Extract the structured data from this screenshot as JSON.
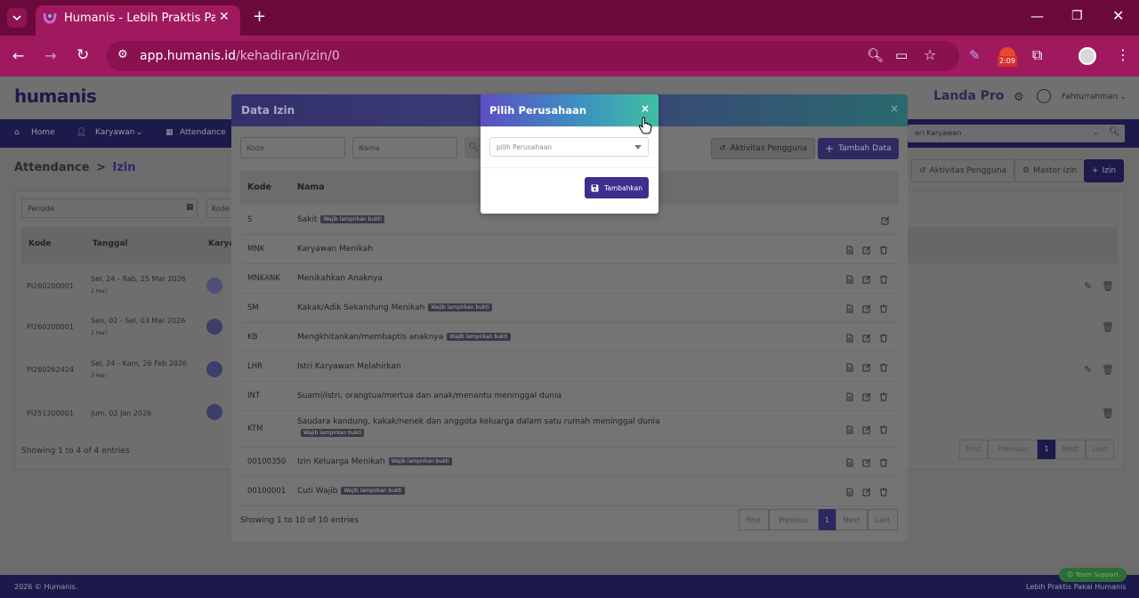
{
  "browser": {
    "tab_title": "Humanis - Lebih Praktis Pakai H",
    "url_domain": "app.humanis.id",
    "url_path": "/kehadiran/izin/0",
    "profile_badge": "2:09",
    "accent": "#a0195f"
  },
  "app": {
    "logo": "humanis",
    "company": "Landa Pro",
    "user": "Fahturrahman",
    "nav": [
      "Home",
      "Karyawan",
      "Attendance"
    ],
    "nav_search_placeholder": "ari Karyawan",
    "breadcrumb_root": "Attendance",
    "breadcrumb_sep": ">",
    "breadcrumb_current": "Izin",
    "btn_aktivitas": "Aktivitas Pengguna",
    "btn_master": "Master Izin",
    "btn_izin": "Izin",
    "filter_periode": "Periode",
    "filter_kode": "Kode",
    "columns": [
      "Kode",
      "Tanggal",
      "Karya"
    ],
    "rows": [
      {
        "kode": "PI260200001",
        "tanggal": "Sel, 24 - Rab, 25 Mar 2026",
        "durasi": "2 Hari"
      },
      {
        "kode": "PI260200001",
        "tanggal": "Sen, 02 - Sel, 03 Mar 2026",
        "durasi": "2 Hari"
      },
      {
        "kode": "PI260262424",
        "tanggal": "Sel, 24 - Kam, 26 Feb 2026",
        "durasi": "3 Hari"
      },
      {
        "kode": "PI251200001",
        "tanggal": "Jum, 02 Jan 2026",
        "durasi": ""
      }
    ],
    "showing": "Showing 1 to 4 of 4 entries",
    "pagination": [
      "First",
      "Previous",
      "1",
      "Next",
      "Last"
    ],
    "footer_left": "2026 © Humanis.",
    "footer_right": "Lebih Praktis Pakai Humanis",
    "support": "Team Support"
  },
  "modal_data_izin": {
    "title": "Data Izin",
    "close": "×",
    "kode_placeholder": "Kode",
    "nama_placeholder": "Nama",
    "btn_aktivitas": "Aktivitas Pengguna",
    "btn_tambah": "Tambah Data",
    "col_kode": "Kode",
    "col_nama": "Nama",
    "badge_text": "Wajib lampirkan bukti",
    "rows": [
      {
        "kode": "S",
        "nama": "Sakit",
        "badge": true
      },
      {
        "kode": "MNK",
        "nama": "Karyawan Menikah",
        "badge": false
      },
      {
        "kode": "MNKANK",
        "nama": "Menikahkan Anaknya",
        "badge": false
      },
      {
        "kode": "SM",
        "nama": "Kakak/Adik Sekandung Menikah",
        "badge": true
      },
      {
        "kode": "KB",
        "nama": "Mengkhitankan/membaptis anaknya",
        "badge": true
      },
      {
        "kode": "LHR",
        "nama": "Istri Karyawan Melahirkan",
        "badge": false
      },
      {
        "kode": "INT",
        "nama": "Suami/istri, orangtua/mertua dan anak/menantu meninggal dunia",
        "badge": false
      },
      {
        "kode": "KTM",
        "nama": "Saudara kandung, kakak/nenek dan anggota keluarga dalam satu rumah meninggal dunia",
        "badge": true
      },
      {
        "kode": "00100350",
        "nama": "Izin Keluarga Menikah",
        "badge": true
      },
      {
        "kode": "00100001",
        "nama": "Cuti Wajib",
        "badge": true
      }
    ],
    "showing": "Showing 1 to 10 of 10 entries",
    "pagination": [
      "First",
      "Previous",
      "1",
      "Next",
      "Last"
    ]
  },
  "modal_pilih": {
    "title": "Pilih Perusahaan",
    "close": "×",
    "select_placeholder": "pilih Perusahaan",
    "btn_label": "Tambahkan",
    "accent": "#3d2f8e"
  }
}
